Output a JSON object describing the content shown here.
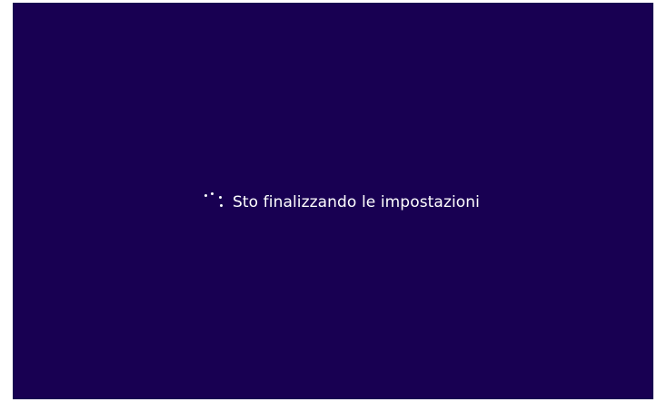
{
  "setup_screen": {
    "status_text": "Sto finalizzando le impostazioni",
    "spinner_icon": "loading-dots-icon",
    "background_color": "#180052",
    "text_color": "#ffffff"
  }
}
